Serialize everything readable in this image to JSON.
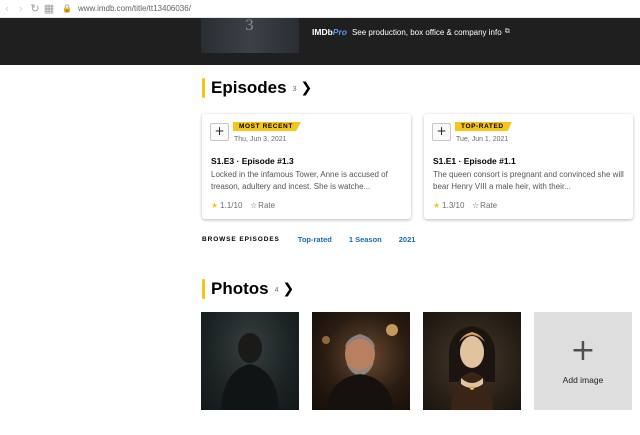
{
  "browser": {
    "back_icon": "back-arrow-icon",
    "forward_icon": "forward-arrow-icon",
    "reload_icon": "reload-icon",
    "url": "www.imdb.com/title/tt13406036/"
  },
  "hero": {
    "poster_glyph": "3",
    "imdbpro_logo_main": "IMDb",
    "imdbpro_logo_pro": "Pro",
    "imdbpro_text": "See production, box office & company info",
    "external_icon": "⧉"
  },
  "episodes": {
    "title": "Episodes",
    "count": "3",
    "chevron": "❯",
    "cards": [
      {
        "badge": "MOST RECENT",
        "date": "Thu, Jun 3, 2021",
        "title": "S1.E3 · Episode #1.3",
        "description": "Locked in the infamous Tower, Anne is accused of treason, adultery and incest. She is watche...",
        "rating": "1.1",
        "rating_max": "/10",
        "rate_label": "Rate"
      },
      {
        "badge": "TOP-RATED",
        "date": "Tue, Jun 1, 2021",
        "title": "S1.E1 · Episode #1.1",
        "description": "The queen consort is pregnant and convinced she will bear Henry VIII a male heir, with their...",
        "rating": "1.3",
        "rating_max": "/10",
        "rate_label": "Rate"
      }
    ],
    "browse_label": "BROWSE EPISODES",
    "browse_links": [
      "Top-rated",
      "1 Season",
      "2021"
    ]
  },
  "photos": {
    "title": "Photos",
    "count": "4",
    "chevron": "❯",
    "add_image_label": "Add image"
  },
  "colors": {
    "accent": "#f5c518",
    "link": "#136cb2",
    "hero_bg": "#1f1f1f"
  }
}
